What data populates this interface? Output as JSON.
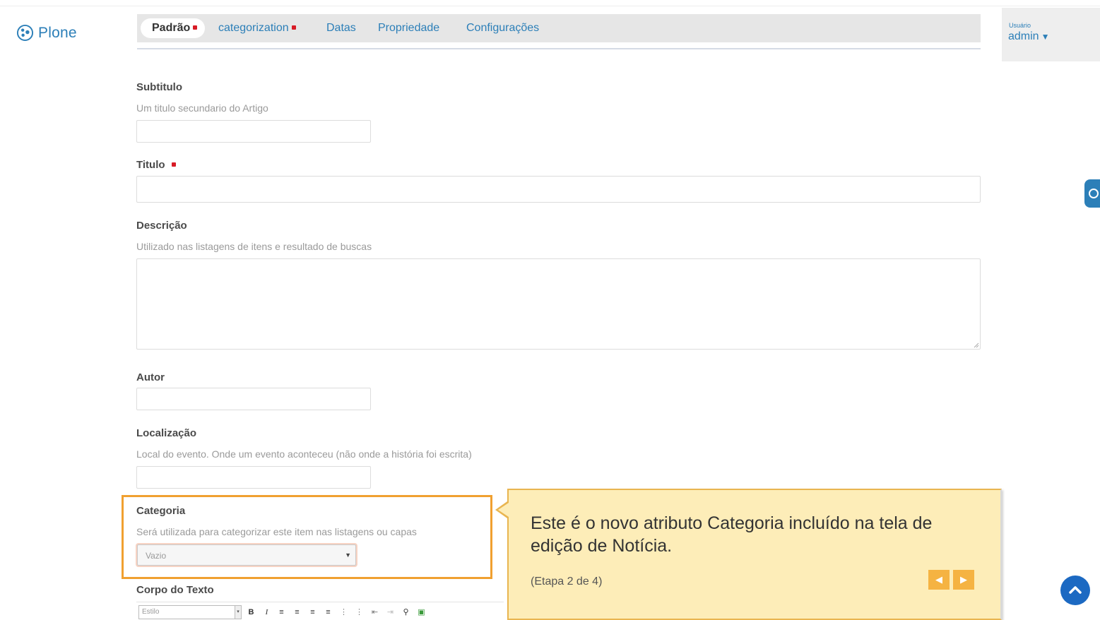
{
  "app": {
    "name": "Plone"
  },
  "user": {
    "label": "Usuário",
    "name": "admin"
  },
  "tabs": [
    {
      "label": "Padrão",
      "required": true,
      "active": true
    },
    {
      "label": "categorization",
      "required": true,
      "active": false
    },
    {
      "label": "Datas",
      "required": false,
      "active": false
    },
    {
      "label": "Propriedade",
      "required": false,
      "active": false
    },
    {
      "label": "Configurações",
      "required": false,
      "active": false
    }
  ],
  "form": {
    "subtitle": {
      "label": "Subtitulo",
      "help": "Um titulo secundario do Artigo",
      "value": ""
    },
    "title": {
      "label": "Titulo",
      "required": true,
      "value": ""
    },
    "description": {
      "label": "Descrição",
      "help": "Utilizado nas listagens de itens e resultado de buscas",
      "value": ""
    },
    "author": {
      "label": "Autor",
      "value": ""
    },
    "location": {
      "label": "Localização",
      "help": "Local do evento. Onde um evento aconteceu (não onde a história foi escrita)",
      "value": ""
    },
    "category": {
      "label": "Categoria",
      "help": "Será utilizada para categorizar este item nas listagens ou capas",
      "selected": "Vazio"
    },
    "body": {
      "label": "Corpo do Texto",
      "style_placeholder": "Estilo"
    }
  },
  "tour": {
    "text": "Este é o novo atributo Categoria incluído na tela de edição de Notícia.",
    "step": "(Etapa 2 de 4)"
  },
  "colors": {
    "link": "#2c7fb8",
    "required": "#d81b26",
    "highlight_border": "#f0a030",
    "tooltip_bg": "#fdedb8",
    "nav_button": "#f5b342",
    "back_to_top": "#1c69c2"
  },
  "icons": [
    "plone-logo-icon",
    "caret-down-icon",
    "prev-arrow-icon",
    "next-arrow-icon",
    "chevron-up-icon",
    "resize-grip-icon",
    "bold-icon",
    "italic-icon",
    "align-left-icon",
    "align-center-icon",
    "align-right-icon",
    "align-justify-icon",
    "bullet-list-icon",
    "numbered-list-icon",
    "outdent-icon",
    "indent-icon",
    "link-icon",
    "image-icon"
  ]
}
